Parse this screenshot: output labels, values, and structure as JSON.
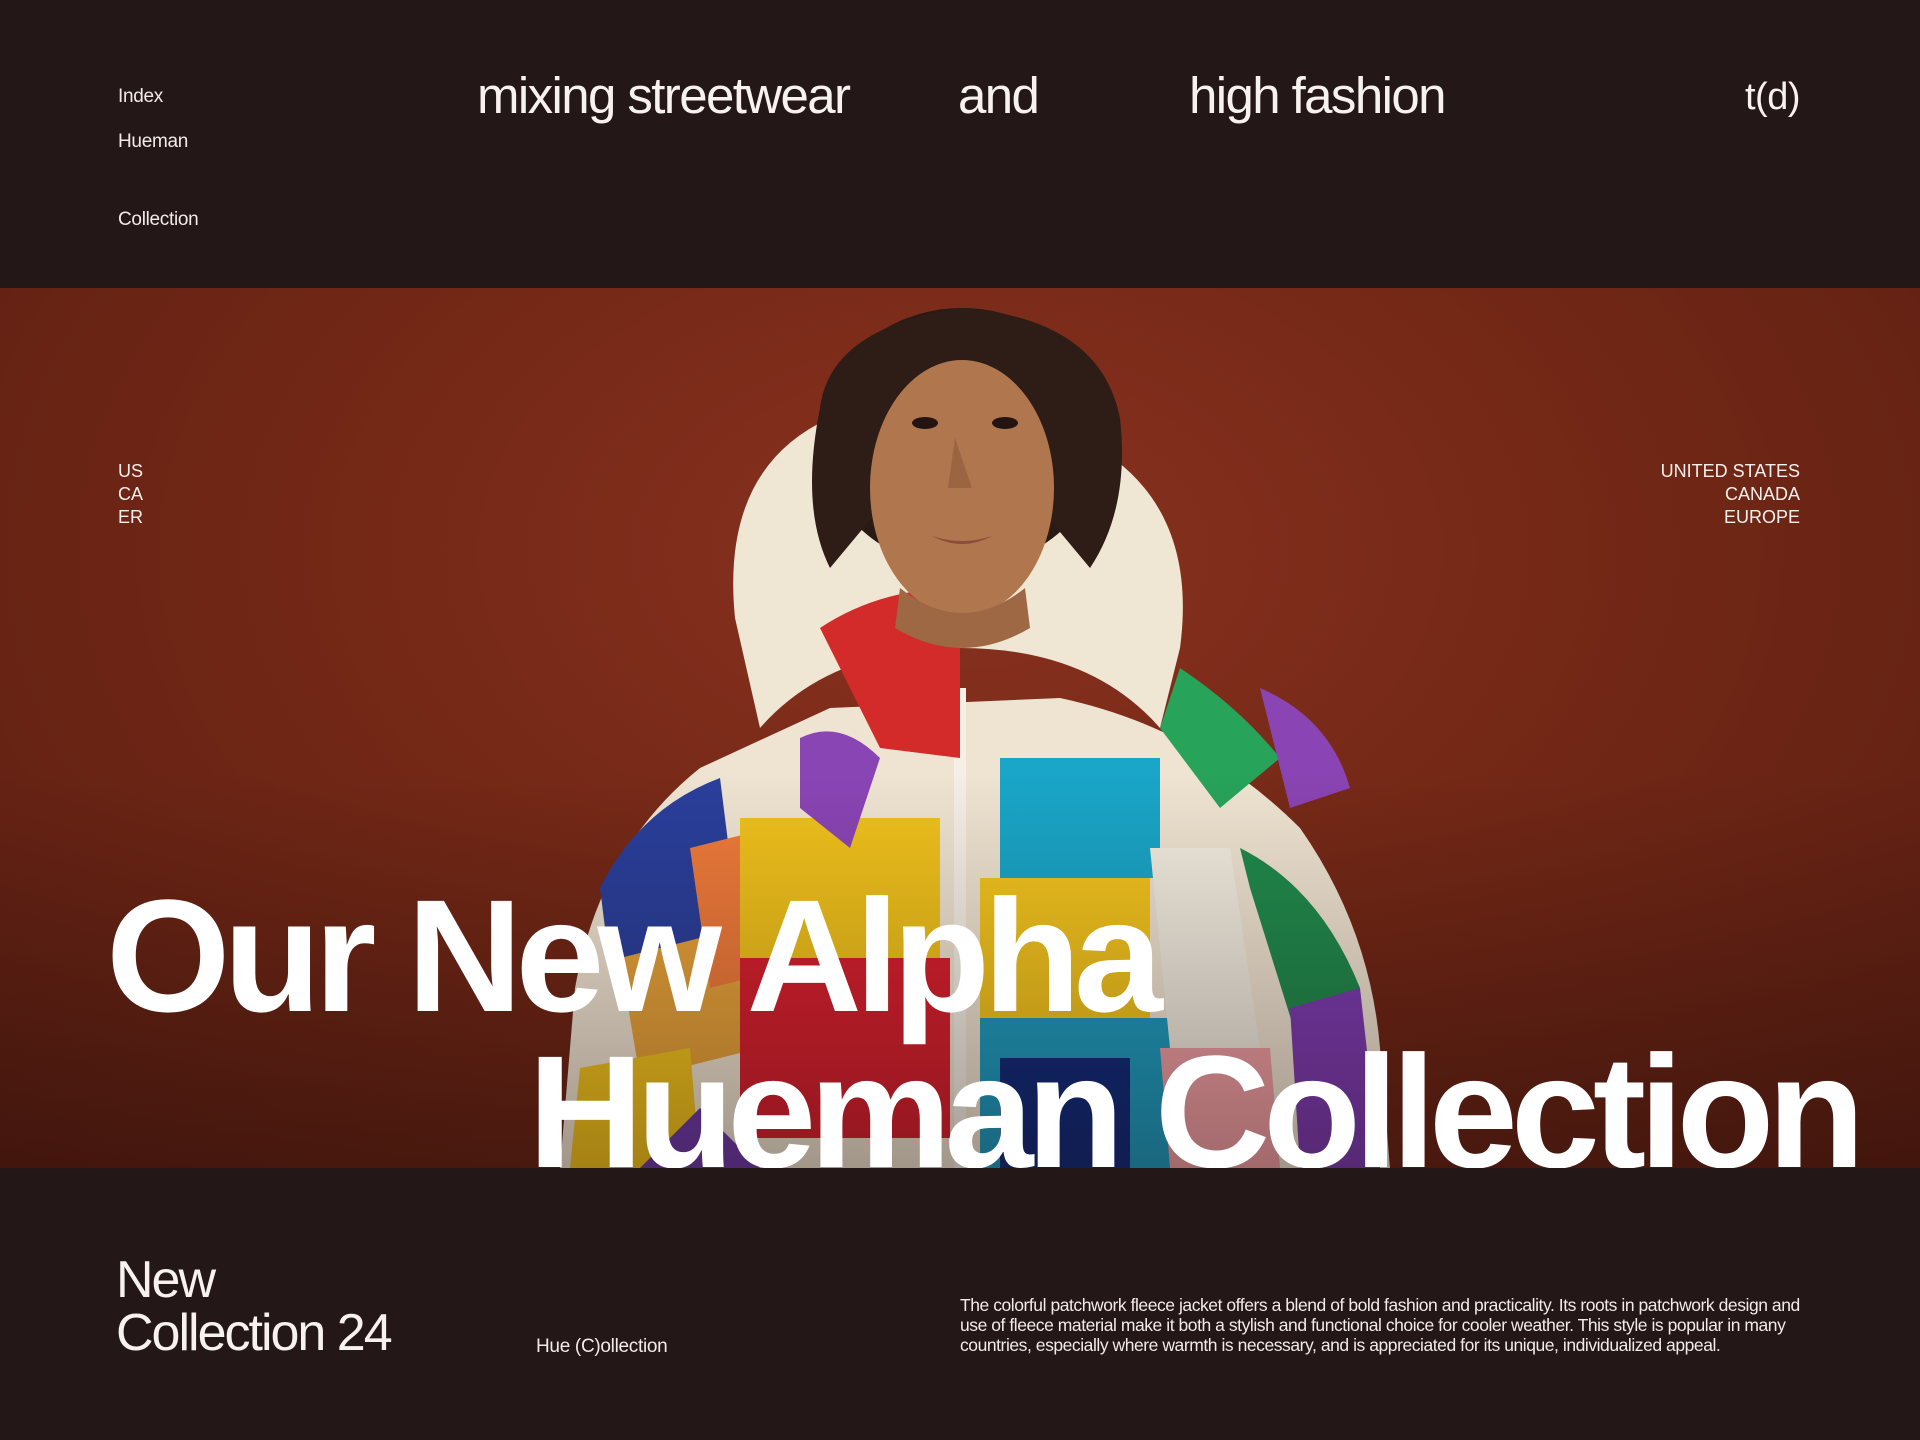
{
  "nav": {
    "items": [
      {
        "label": "Index"
      },
      {
        "label": "Hueman"
      },
      {
        "label": "Collection"
      }
    ]
  },
  "tagline": {
    "word1": "mixing streetwear",
    "word2": "and",
    "word3": "high fashion"
  },
  "logo": "t(d)",
  "regions": {
    "codes": [
      "US",
      "CA",
      "ER"
    ],
    "names": [
      "UNITED STATES",
      "CANADA",
      "EUROPE"
    ]
  },
  "hero": {
    "line1": "Our New Alpha",
    "line2": "Hueman Collection"
  },
  "footer": {
    "collection_line1": "New",
    "collection_line2": "Collection 24",
    "label": "Hue (C)ollection",
    "description": "The colorful patchwork fleece jacket offers a blend of bold fashion and practicality. Its roots in patchwork design and use of fleece material make it both a stylish and functional choice for cooler weather. This style is popular in many countries, especially where warmth is necessary, and is appreciated for its unique, individualized appeal."
  },
  "colors": {
    "background": "#231717",
    "hero_backdrop": "#742816",
    "text": "#f4ecea"
  }
}
